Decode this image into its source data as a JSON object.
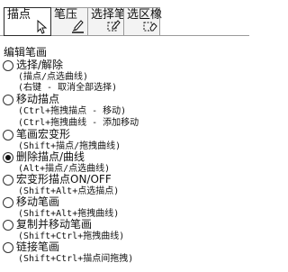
{
  "tabs": [
    {
      "label": "描点",
      "icon": "cursor-arrow-icon",
      "active": true
    },
    {
      "label": "笔压",
      "icon": "pen-pressure-icon",
      "active": false
    },
    {
      "label": "选择笔",
      "icon": "selection-pen-icon",
      "active": false
    },
    {
      "label": "选区橡",
      "icon": "selection-eraser-icon",
      "active": false
    }
  ],
  "group": {
    "title": "编辑笔画"
  },
  "options": [
    {
      "label": "选择/解除",
      "hints": [
        "(描点/点选曲线)",
        "(右键 - 取消全部选择)"
      ],
      "selected": false
    },
    {
      "label": "移动描点",
      "hints": [
        "(Ctrl+拖拽描点 - 移动)",
        "(Ctrl+拖拽曲线 - 添加移动"
      ],
      "selected": false
    },
    {
      "label": "笔画宏变形",
      "hints": [
        "(Shift+描点/拖拽曲线)"
      ],
      "selected": false
    },
    {
      "label": "删除描点/曲线",
      "hints": [
        "(Alt+描点/点选曲线)"
      ],
      "selected": true
    },
    {
      "label": "宏变形描点ON/OFF",
      "hints": [
        "(Shift+Alt+点选描点)"
      ],
      "selected": false
    },
    {
      "label": "移动笔画",
      "hints": [
        "(Shift+Alt+拖拽曲线)"
      ],
      "selected": false
    },
    {
      "label": "复制并移动笔画",
      "hints": [
        "(Shift+Ctrl+拖拽曲线)"
      ],
      "selected": false
    },
    {
      "label": "链接笔画",
      "hints": [
        "(Shift+Ctrl+描点间拖拽)"
      ],
      "selected": false
    }
  ],
  "colors": {
    "border": "#2b2b2b",
    "tab_bg": "#f3f3f3",
    "background": "#ffffff"
  }
}
